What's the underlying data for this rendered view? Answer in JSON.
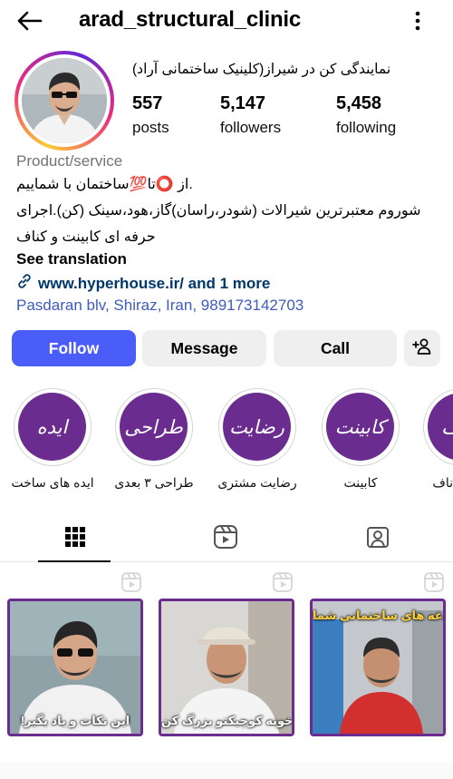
{
  "header": {
    "username": "arad_structural_clinic"
  },
  "profile": {
    "display_name": "نمایندگی کن در شیراز(کلینیک ساختمانی آراد)",
    "stats": [
      {
        "value": "557",
        "label": "posts"
      },
      {
        "value": "5,147",
        "label": "followers"
      },
      {
        "value": "5,458",
        "label": "following"
      }
    ],
    "category": "Product/service",
    "bio_lines": [
      ".از ⭕تا💯ساختمان با شماییم",
      "شوروم معتبرترین شیرالات (شودر،راسان)گاز،هود،سینک (کن).اجرای",
      "حرفه ای کابینت و کناف"
    ],
    "see_translation": "See translation",
    "link": "www.hyperhouse.ir/ and 1 more",
    "address": "Pasdaran blv, Shiraz, Iran,  989173142703"
  },
  "actions": {
    "follow": "Follow",
    "message": "Message",
    "call": "Call"
  },
  "highlights": [
    {
      "title": "ایده",
      "label": "ایده های ساخت"
    },
    {
      "title": "طراحی",
      "label": "طراحی ۳ بعدی"
    },
    {
      "title": "رضایت",
      "label": "رضایت مشتری"
    },
    {
      "title": "کابینت",
      "label": "کابینت"
    },
    {
      "title": "کناف",
      "label": "ناف"
    }
  ],
  "posts": [
    {
      "caption": "!این نکات و یاد بگیر"
    },
    {
      "caption": "خونه کوچیکتو بزرگ کن"
    },
    {
      "caption": "دغدغه های ساختمانی شما"
    }
  ],
  "colors": {
    "follow_button": "#4a5df9",
    "highlight_fill": "#6b2c8f",
    "address_link": "#3f5bbd"
  }
}
